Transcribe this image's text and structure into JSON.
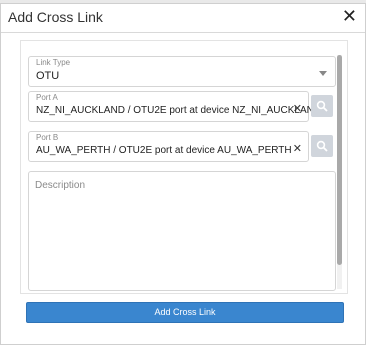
{
  "dialog": {
    "title": "Add Cross Link",
    "close_label": "✕"
  },
  "link_type": {
    "label": "Link Type",
    "value": "OTU"
  },
  "port_a": {
    "label": "Port A",
    "value": "NZ_NI_AUCKLAND / OTU2E port at device NZ_NI_AUCKLAND",
    "clear_label": "✕"
  },
  "port_b": {
    "label": "Port B",
    "value": "AU_WA_PERTH / OTU2E port at device AU_WA_PERTH",
    "clear_label": "✕"
  },
  "description": {
    "placeholder": "Description"
  },
  "submit": {
    "label": "Add Cross Link"
  },
  "colors": {
    "primary": "#3a86cf",
    "search_button": "#d0d5dc"
  }
}
